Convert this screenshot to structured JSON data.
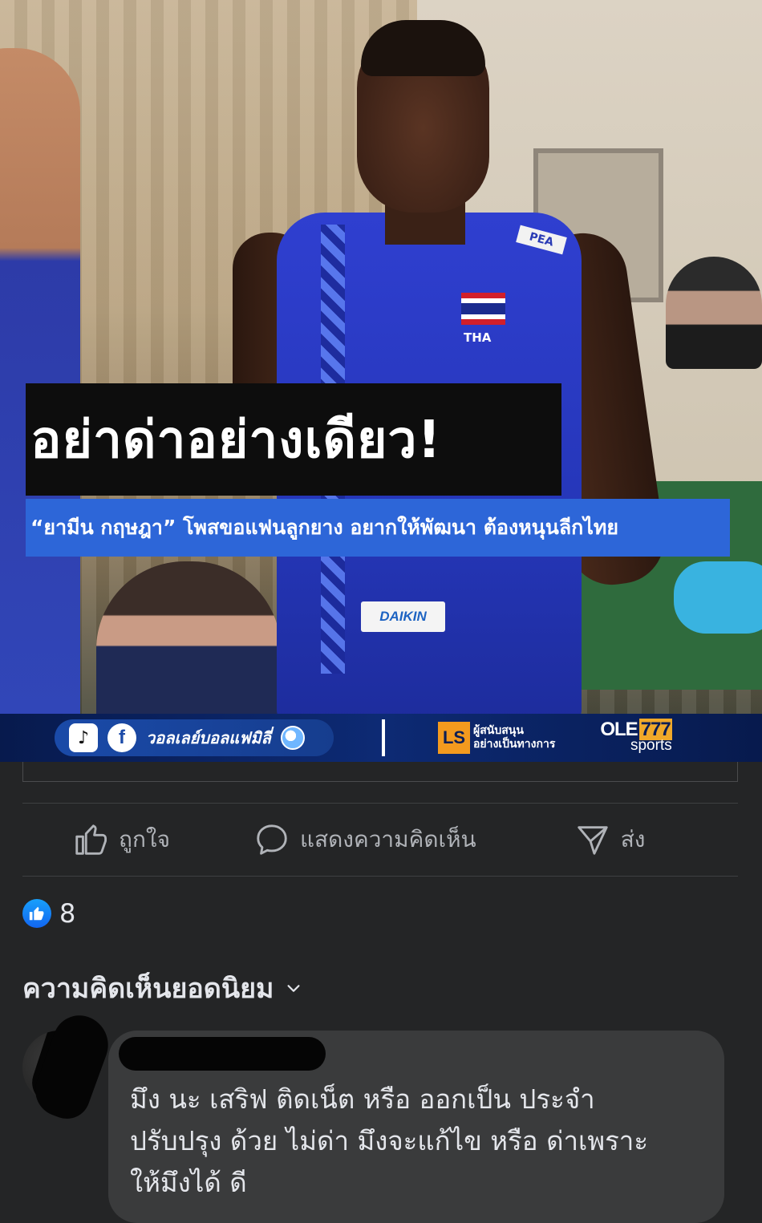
{
  "image": {
    "headline": "อย่าด่าอย่างเดียว!",
    "subheadline": "“ยามีน กฤษฎา” โพสขอแฟนลูกยาง อยากให้พัฒนา ต้องหนุนลีกไทย",
    "jersey_country": "THA",
    "jersey_sponsor_top": "PEA",
    "jersey_sponsor_bottom": "DAIKIN",
    "page_brand": "วอลเลย์บอลแฟมิลี่",
    "sponsor_line1": "ผู้สนับสนุน",
    "sponsor_line2": "อย่างเป็นทางการ",
    "sponsor_logo": "LS",
    "ole_brand": "OLE",
    "ole_number": "777",
    "ole_sub": "sports",
    "social_tiktok": "♪",
    "social_facebook": "f"
  },
  "actions": {
    "like": "ถูกใจ",
    "comment": "แสดงความคิดเห็น",
    "share": "ส่ง"
  },
  "reactions": {
    "count": "8"
  },
  "comments_section": {
    "sort_label": "ความคิดเห็นยอดนิยม"
  },
  "comment": {
    "text": "มึง นะ เสริฟ ติดเน็ต  หรือ ออกเป็น ประจำ\nปรับปรุง ด้วย ไม่ด่า มึงจะแก้ไข หรือ ด่าเพราะ\nให้มึงได้ ดี"
  },
  "colors": {
    "background": "#242526",
    "bubble": "#3a3b3c",
    "accent_blue": "#2d66d8",
    "like_blue": "#1877f2"
  }
}
